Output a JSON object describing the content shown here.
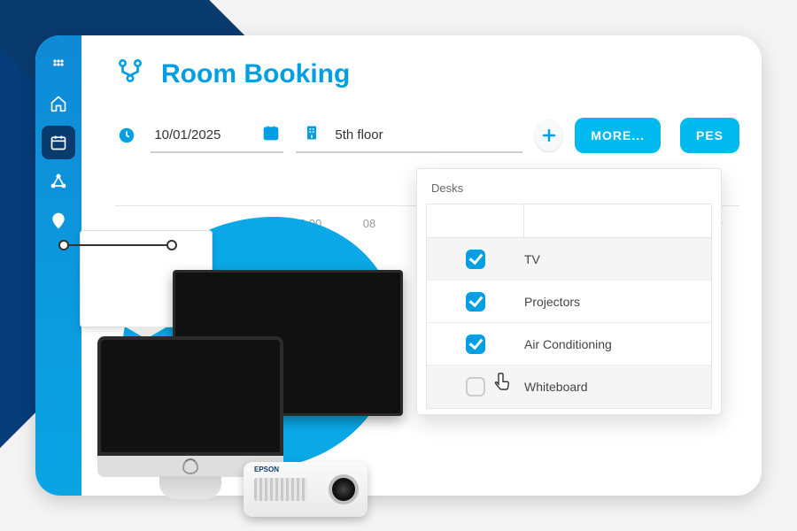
{
  "header": {
    "title": "Room Booking"
  },
  "filters": {
    "date": "10/01/2025",
    "floor": "5th floor",
    "more_btn": "MORE...",
    "secondary_btn": "PES"
  },
  "timeline": {
    "ticks": [
      "08:00",
      "08"
    ],
    "last_tick": "11:00"
  },
  "desk_panel": {
    "title": "Desks",
    "rows": [
      {
        "label": "TV",
        "checked": true
      },
      {
        "label": "Projectors",
        "checked": true
      },
      {
        "label": "Air Conditioning",
        "checked": true
      },
      {
        "label": "Whiteboard",
        "checked": false
      }
    ]
  },
  "sidebar": {
    "items": [
      {
        "name": "apps-icon",
        "active": false
      },
      {
        "name": "home-icon",
        "active": false
      },
      {
        "name": "calendar-icon",
        "active": true
      },
      {
        "name": "network-icon",
        "active": false
      },
      {
        "name": "map-pin-icon",
        "active": false
      }
    ]
  },
  "projector_brand": "EPSON"
}
